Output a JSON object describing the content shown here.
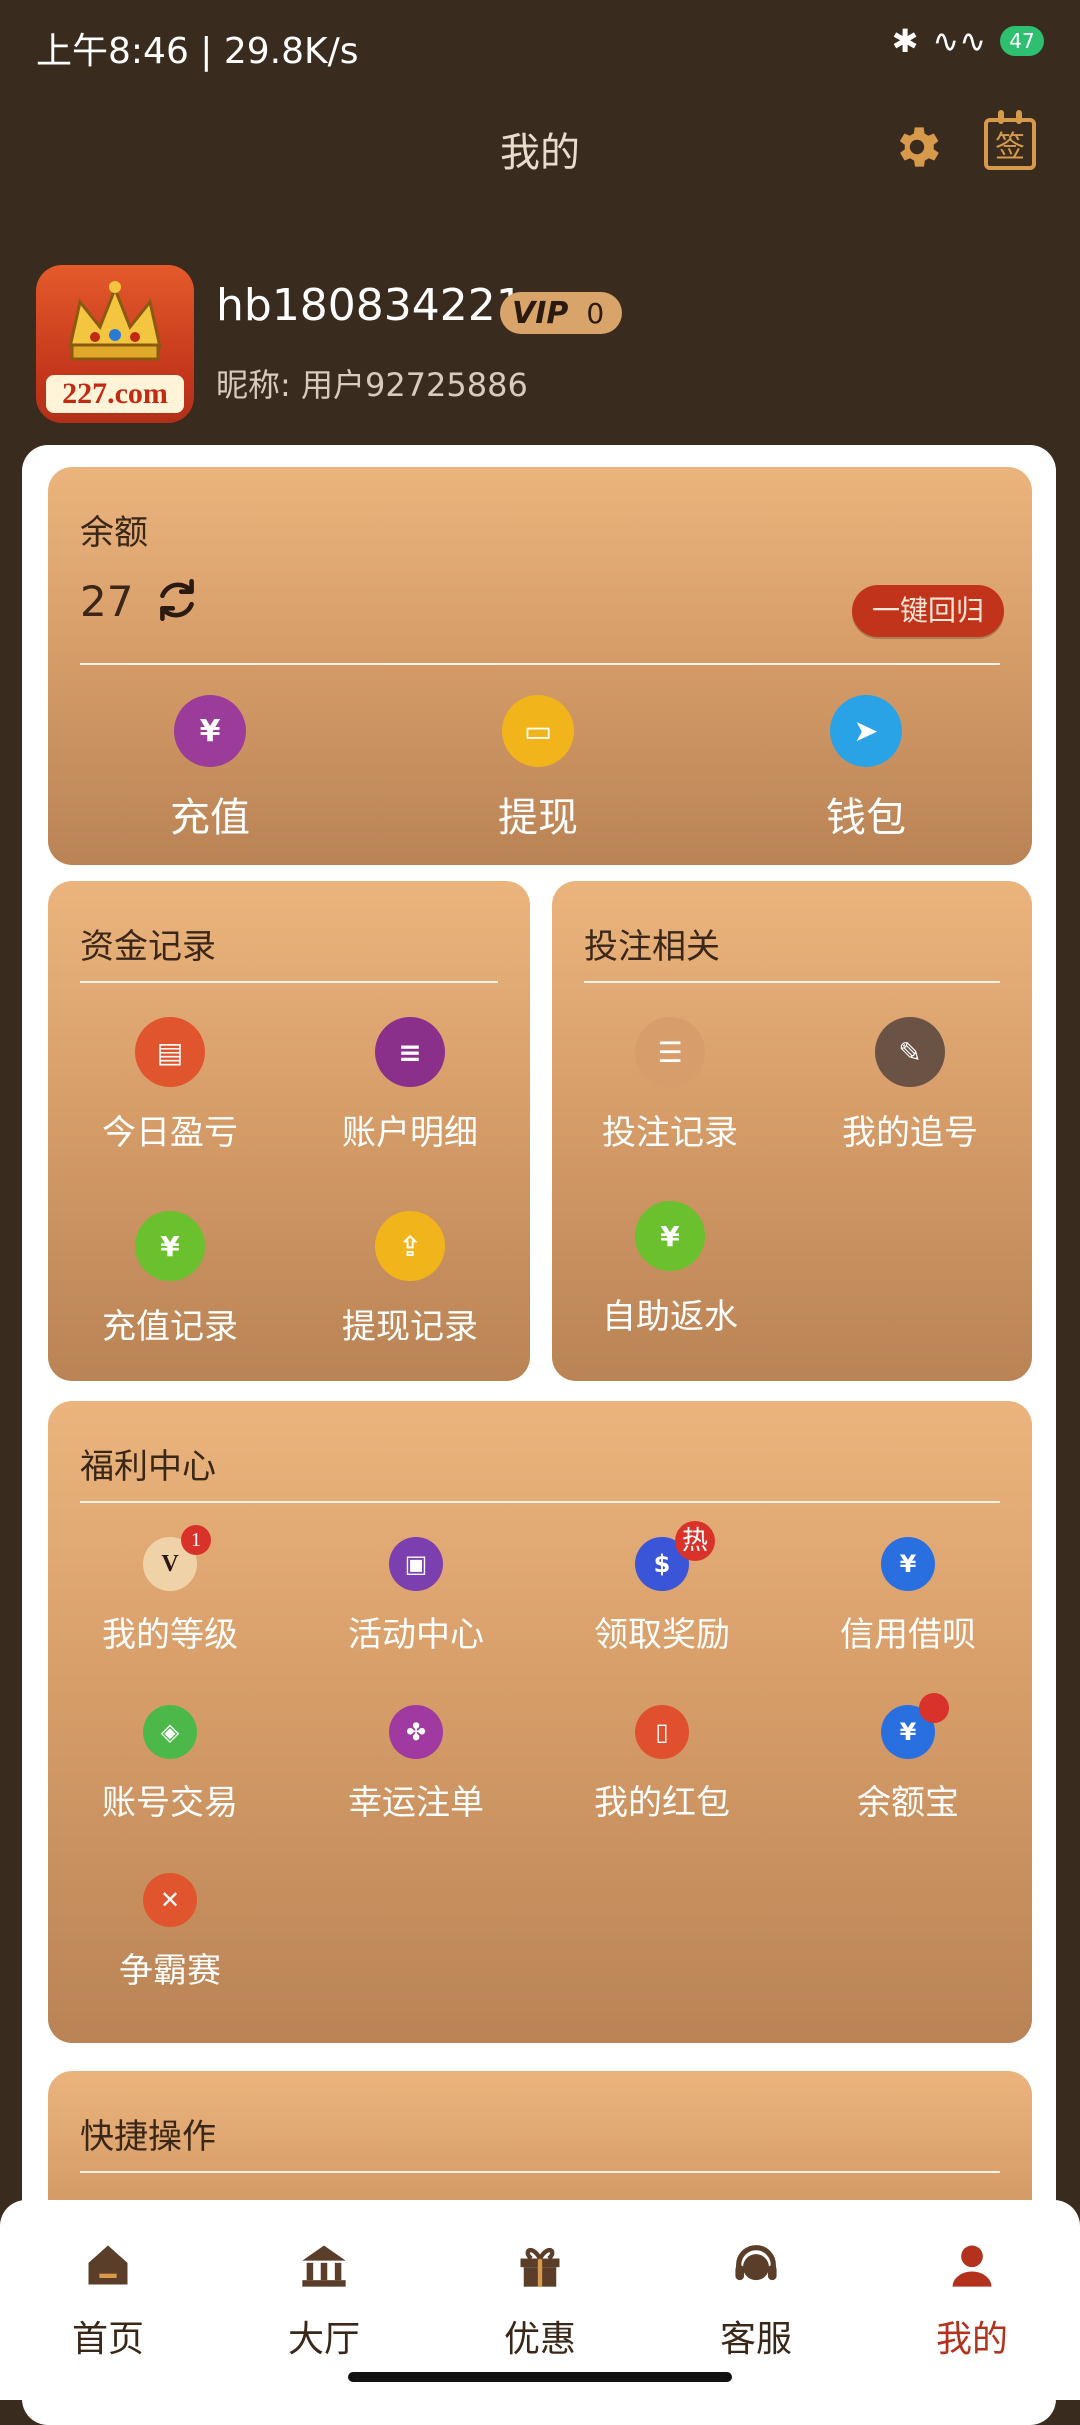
{
  "status_bar": {
    "left_text": "上午8:46 | 29.8K/s",
    "battery": "47"
  },
  "header": {
    "title": "我的",
    "sign_label": "签"
  },
  "profile": {
    "avatar_text": "227.com",
    "username": "hb180834221",
    "vip_label": "VIP",
    "vip_level": "0",
    "nickname": "昵称: 用户92725886"
  },
  "balance": {
    "title": "余额",
    "amount": "27",
    "recall_label": "一键回归",
    "actions": [
      {
        "label": "充值",
        "icon": "piggy-bank-icon",
        "color": "#9b3b9a"
      },
      {
        "label": "提现",
        "icon": "wallet-icon",
        "color": "#f1b41a"
      },
      {
        "label": "钱包",
        "icon": "paper-plane-icon",
        "color": "#2aa3e6"
      }
    ]
  },
  "funds": {
    "title": "资金记录",
    "items": [
      {
        "label": "今日盈亏",
        "icon": "chart-icon",
        "color": "#e0552e"
      },
      {
        "label": "账户明细",
        "icon": "document-icon",
        "color": "#8a2f8a"
      },
      {
        "label": "充值记录",
        "icon": "yuan-card-icon",
        "color": "#6bc02e"
      },
      {
        "label": "提现记录",
        "icon": "cash-box-icon",
        "color": "#f1b41a"
      }
    ]
  },
  "bets": {
    "title": "投注相关",
    "items": [
      {
        "label": "投注记录",
        "icon": "list-icon",
        "color": "#d79d6a"
      },
      {
        "label": "我的追号",
        "icon": "edit-doc-icon",
        "color": "#6a5244"
      },
      {
        "label": "自助返水",
        "icon": "money-bag-icon",
        "color": "#6bc02e"
      }
    ]
  },
  "welfare": {
    "title": "福利中心",
    "items": [
      {
        "label": "我的等级",
        "icon": "vip-level-icon",
        "color": "#6a4a2f",
        "badge": "1"
      },
      {
        "label": "活动中心",
        "icon": "gift-icon",
        "color": "#7b3fb0"
      },
      {
        "label": "领取奖励",
        "icon": "reward-hand-icon",
        "color": "#3a55d8",
        "badge": "热"
      },
      {
        "label": "信用借呗",
        "icon": "credit-icon",
        "color": "#2a6fe0"
      },
      {
        "label": "账号交易",
        "icon": "shield-icon",
        "color": "#4cb84a"
      },
      {
        "label": "幸运注单",
        "icon": "clover-icon",
        "color": "#a03aa0"
      },
      {
        "label": "我的红包",
        "icon": "red-envelope-icon",
        "color": "#e0502e"
      },
      {
        "label": "余额宝",
        "icon": "money-pouch-icon",
        "color": "#2a6fe0"
      },
      {
        "label": "争霸赛",
        "icon": "swords-icon",
        "color": "#e0552e"
      }
    ]
  },
  "quick": {
    "title": "快捷操作"
  },
  "nav": [
    {
      "label": "首页",
      "icon": "home-icon"
    },
    {
      "label": "大厅",
      "icon": "hall-icon"
    },
    {
      "label": "优惠",
      "icon": "gift-icon"
    },
    {
      "label": "客服",
      "icon": "headset-icon"
    },
    {
      "label": "我的",
      "icon": "user-icon",
      "active": true
    }
  ]
}
